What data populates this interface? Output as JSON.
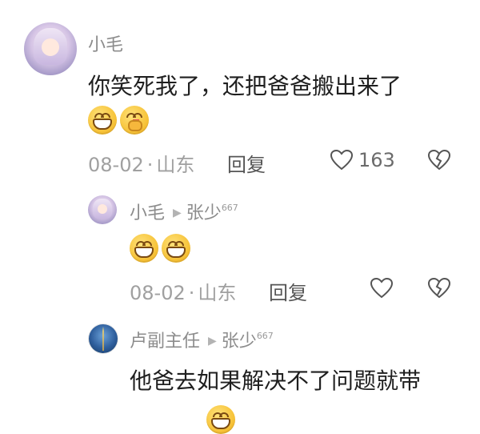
{
  "comments": [
    {
      "user": "小毛",
      "text": "你笑死我了，还把爸爸搬出来了",
      "emojis": [
        "grin-emoji",
        "thinking-emoji"
      ],
      "date": "08-02",
      "location": "山东",
      "reply_label": "回复",
      "like_count": "163"
    }
  ],
  "replies": [
    {
      "user": "小毛",
      "reply_to": "张少",
      "reply_to_badge": "667",
      "emojis": [
        "grin-emoji",
        "grin-emoji"
      ],
      "date": "08-02",
      "location": "山东",
      "reply_label": "回复"
    },
    {
      "user": "卢副主任",
      "reply_to": "张少",
      "reply_to_badge": "667",
      "text": "他爸去如果解决不了问题就带"
    }
  ],
  "separator": "·"
}
